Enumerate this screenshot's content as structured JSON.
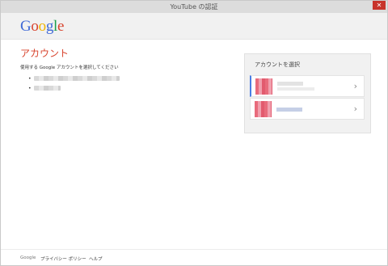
{
  "window": {
    "title": "YouTube の認証",
    "close_glyph": "✕"
  },
  "logo": {
    "letters": [
      "G",
      "o",
      "o",
      "g",
      "l",
      "e"
    ]
  },
  "main": {
    "heading": "アカウント",
    "subtitle": "使用する Google アカウントを選択してください",
    "bullet_glyph": "•"
  },
  "chooser": {
    "title": "アカウントを選択",
    "chevron_glyph": "›"
  },
  "footer": {
    "brand": "Google",
    "privacy": "プライバシー ポリシー",
    "help": "ヘルプ"
  }
}
